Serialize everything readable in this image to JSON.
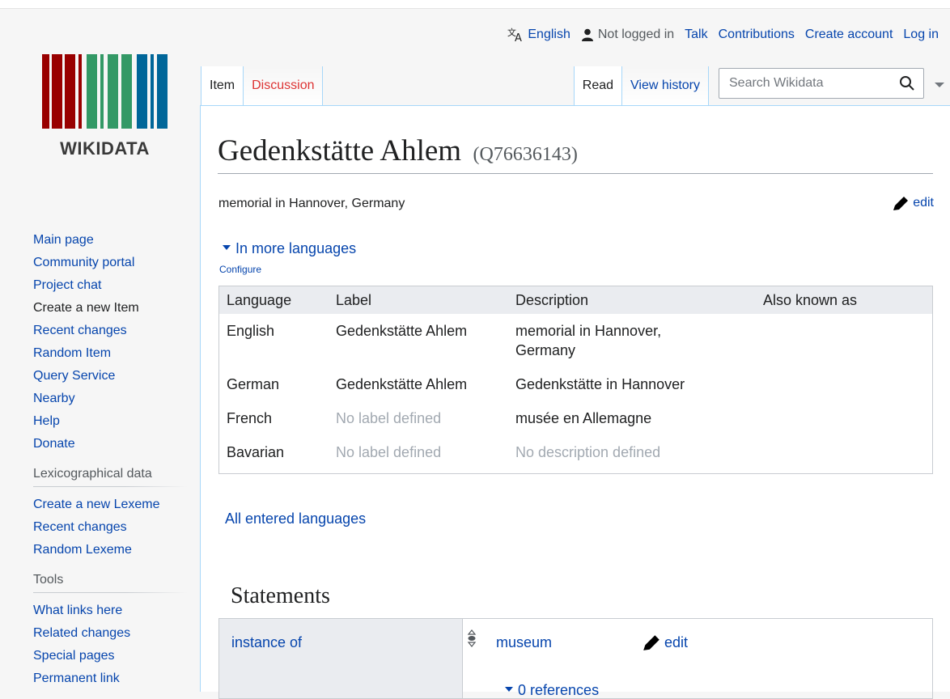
{
  "personal": {
    "language": "English",
    "not_logged_in": "Not logged in",
    "talk": "Talk",
    "contributions": "Contributions",
    "create_account": "Create account",
    "log_in": "Log in"
  },
  "logo": {
    "word": "WIKIDATA"
  },
  "sidebar": {
    "nav": [
      "Main page",
      "Community portal",
      "Project chat",
      "Create a new Item",
      "Recent changes",
      "Random Item",
      "Query Service",
      "Nearby",
      "Help",
      "Donate"
    ],
    "lexicographical_heading": "Lexicographical data",
    "lexicographical": [
      "Create a new Lexeme",
      "Recent changes",
      "Random Lexeme"
    ],
    "tools_heading": "Tools",
    "tools": [
      "What links here",
      "Related changes",
      "Special pages",
      "Permanent link"
    ]
  },
  "tabs": {
    "item": "Item",
    "discussion": "Discussion",
    "read": "Read",
    "view_history": "View history"
  },
  "search": {
    "placeholder": "Search Wikidata"
  },
  "page": {
    "title": "Gedenkstätte Ahlem",
    "qid": "(Q76636143)",
    "description": "memorial in Hannover, Germany",
    "edit": "edit",
    "in_more_languages": "In more languages",
    "configure": "Configure",
    "all_entered_languages": "All entered languages",
    "statements_heading": "Statements"
  },
  "lang_table": {
    "headers": [
      "Language",
      "Label",
      "Description",
      "Also known as"
    ],
    "rows": [
      {
        "language": "English",
        "label": "Gedenkstätte Ahlem",
        "description": "memorial in Hannover, Germany",
        "aka": ""
      },
      {
        "language": "German",
        "label": "Gedenkstätte Ahlem",
        "description": "Gedenkstätte in Hannover",
        "aka": ""
      },
      {
        "language": "French",
        "label": "No label defined",
        "description": "musée en Allemagne",
        "aka": ""
      },
      {
        "language": "Bavarian",
        "label": "No label defined",
        "description": "No description defined",
        "aka": ""
      }
    ]
  },
  "statement": {
    "property": "instance of",
    "value": "museum",
    "edit": "edit",
    "references": "0 references"
  },
  "colors": {
    "link": "#0645ad",
    "red_link": "#d33",
    "tab_border": "#a7d7f9"
  }
}
